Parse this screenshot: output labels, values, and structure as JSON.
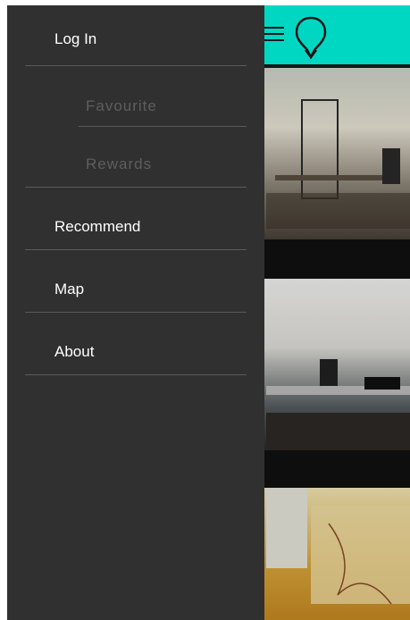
{
  "header": {
    "bar_color": "#00f5df",
    "menu_icon": "hamburger-menu-icon",
    "logo_icon": "location-pin-icon"
  },
  "drawer": {
    "items": [
      {
        "label": "Log In"
      },
      {
        "label": "Favourite",
        "disabled": true
      },
      {
        "label": "Rewards",
        "disabled": true
      },
      {
        "label": "Recommend"
      },
      {
        "label": "Map"
      },
      {
        "label": "About"
      }
    ]
  },
  "colors": {
    "drawer_bg": "#303030",
    "divider": "#5a5a5a",
    "item_text": "#ffffff",
    "disabled_text": "#5e5e5e",
    "accent": "#00f5df"
  }
}
